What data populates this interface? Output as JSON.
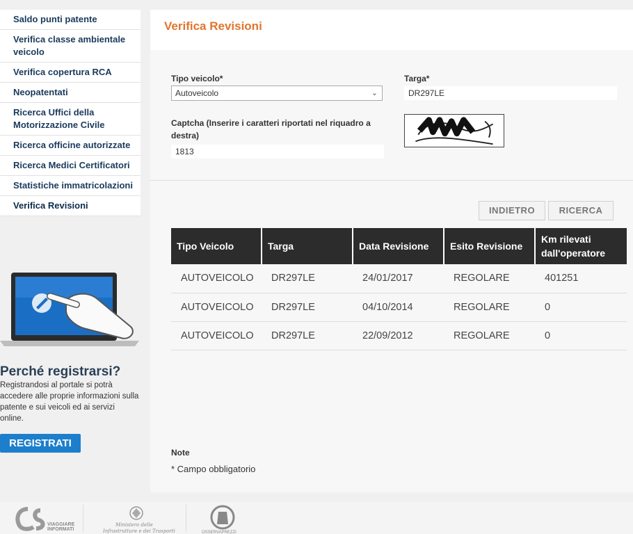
{
  "sidebar": {
    "items": [
      {
        "label": "Saldo punti patente"
      },
      {
        "label": "Verifica classe ambientale veicolo"
      },
      {
        "label": "Verifica copertura RCA"
      },
      {
        "label": "Neopatentati"
      },
      {
        "label": "Ricerca Uffici della Motorizzazione Civile"
      },
      {
        "label": "Ricerca officine autorizzate"
      },
      {
        "label": "Ricerca Medici Certificatori"
      },
      {
        "label": "Statistiche immatricolazioni"
      },
      {
        "label": "Verifica Revisioni"
      }
    ]
  },
  "promo": {
    "title": "Perché registrarsi?",
    "text": "Registrandosi al portale si potrà accedere alle proprie informazioni sulla patente e sui  veicoli ed ai servizi online.",
    "button": "REGISTRATI"
  },
  "page": {
    "title": "Verifica Revisioni"
  },
  "form": {
    "tipo_label": "Tipo veicolo*",
    "tipo_value": "Autoveicolo",
    "targa_label": "Targa*",
    "targa_value": "DR297LE",
    "captcha_label": "Captcha (Inserire i caratteri riportati nel riquadro a destra)",
    "captcha_value": "1813"
  },
  "buttons": {
    "back": "INDIETRO",
    "search": "RICERCA"
  },
  "table": {
    "headers": [
      "Tipo Veicolo",
      "Targa",
      "Data Revisione",
      "Esito Revisione",
      "Km rilevati dall'operatore"
    ],
    "rows": [
      [
        "AUTOVEICOLO",
        "DR297LE",
        "24/01/2017",
        "REGOLARE",
        "401251"
      ],
      [
        "AUTOVEICOLO",
        "DR297LE",
        "04/10/2014",
        "REGOLARE",
        "0"
      ],
      [
        "AUTOVEICOLO",
        "DR297LE",
        "22/09/2012",
        "REGOLARE",
        "0"
      ]
    ]
  },
  "notes": {
    "label": "Note",
    "text": "* Campo obbligatorio"
  },
  "footer": {
    "logo1": "VIAGGIARE INFORMATI",
    "logo2": "Ministero delle Infrastrutture e dei Trasporti",
    "logo3": "OSSERVAPREZZI"
  },
  "colors": {
    "title_orange": "#e0752d",
    "header_dark": "#2c2c2c",
    "register_blue": "#1d7fcb"
  }
}
